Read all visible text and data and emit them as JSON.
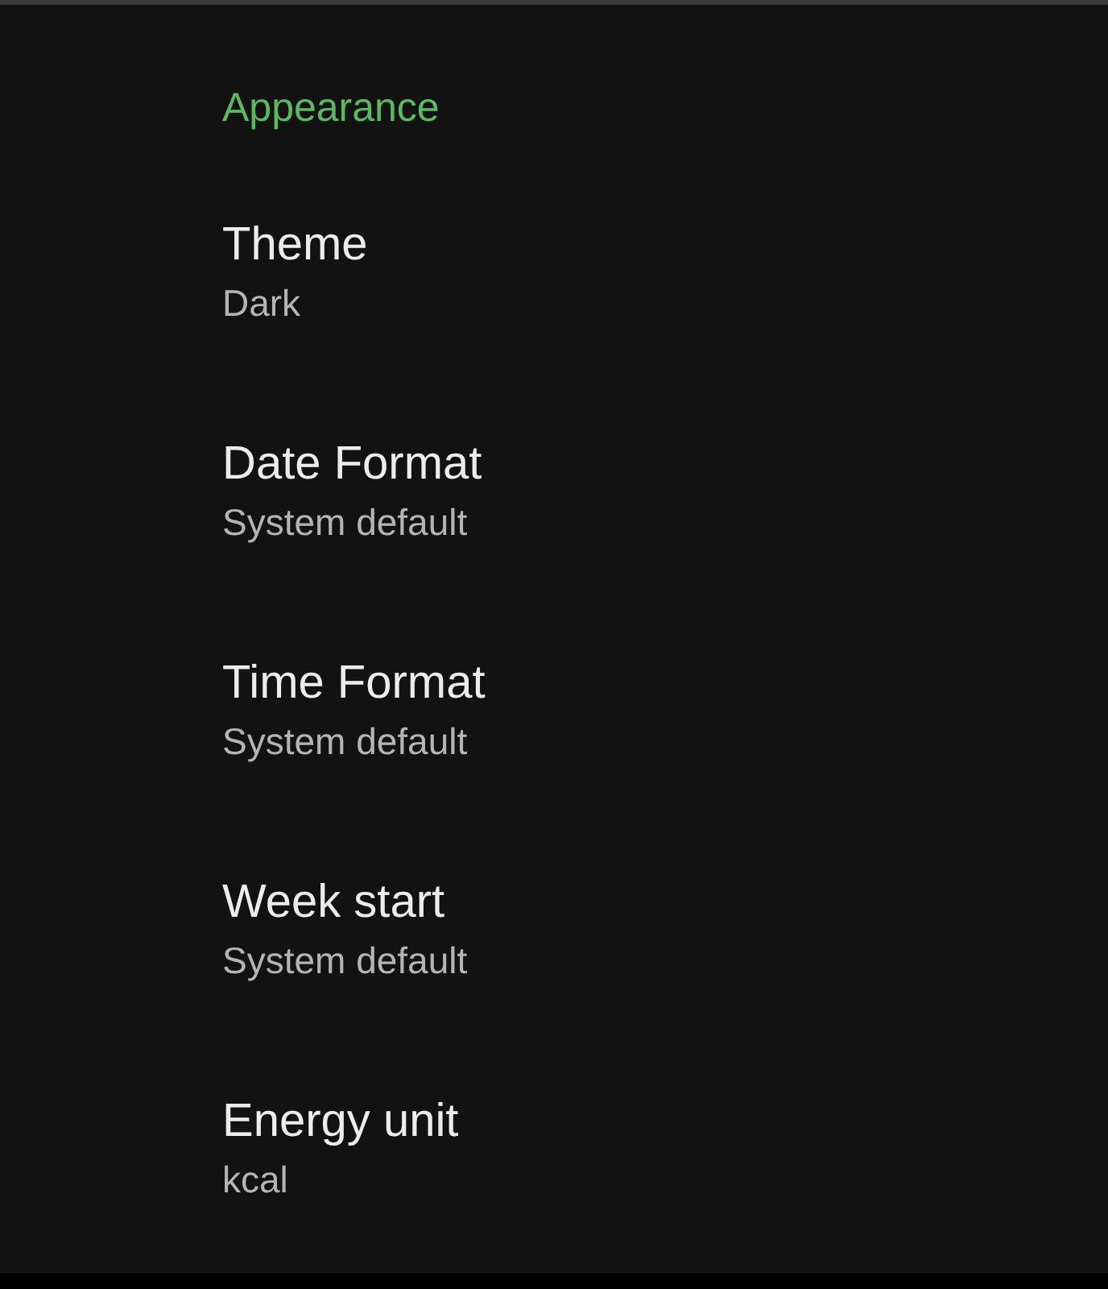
{
  "section": {
    "title": "Appearance"
  },
  "settings": [
    {
      "title": "Theme",
      "value": "Dark"
    },
    {
      "title": "Date Format",
      "value": "System default"
    },
    {
      "title": "Time Format",
      "value": "System default"
    },
    {
      "title": "Week start",
      "value": "System default"
    },
    {
      "title": "Energy unit",
      "value": "kcal"
    }
  ]
}
